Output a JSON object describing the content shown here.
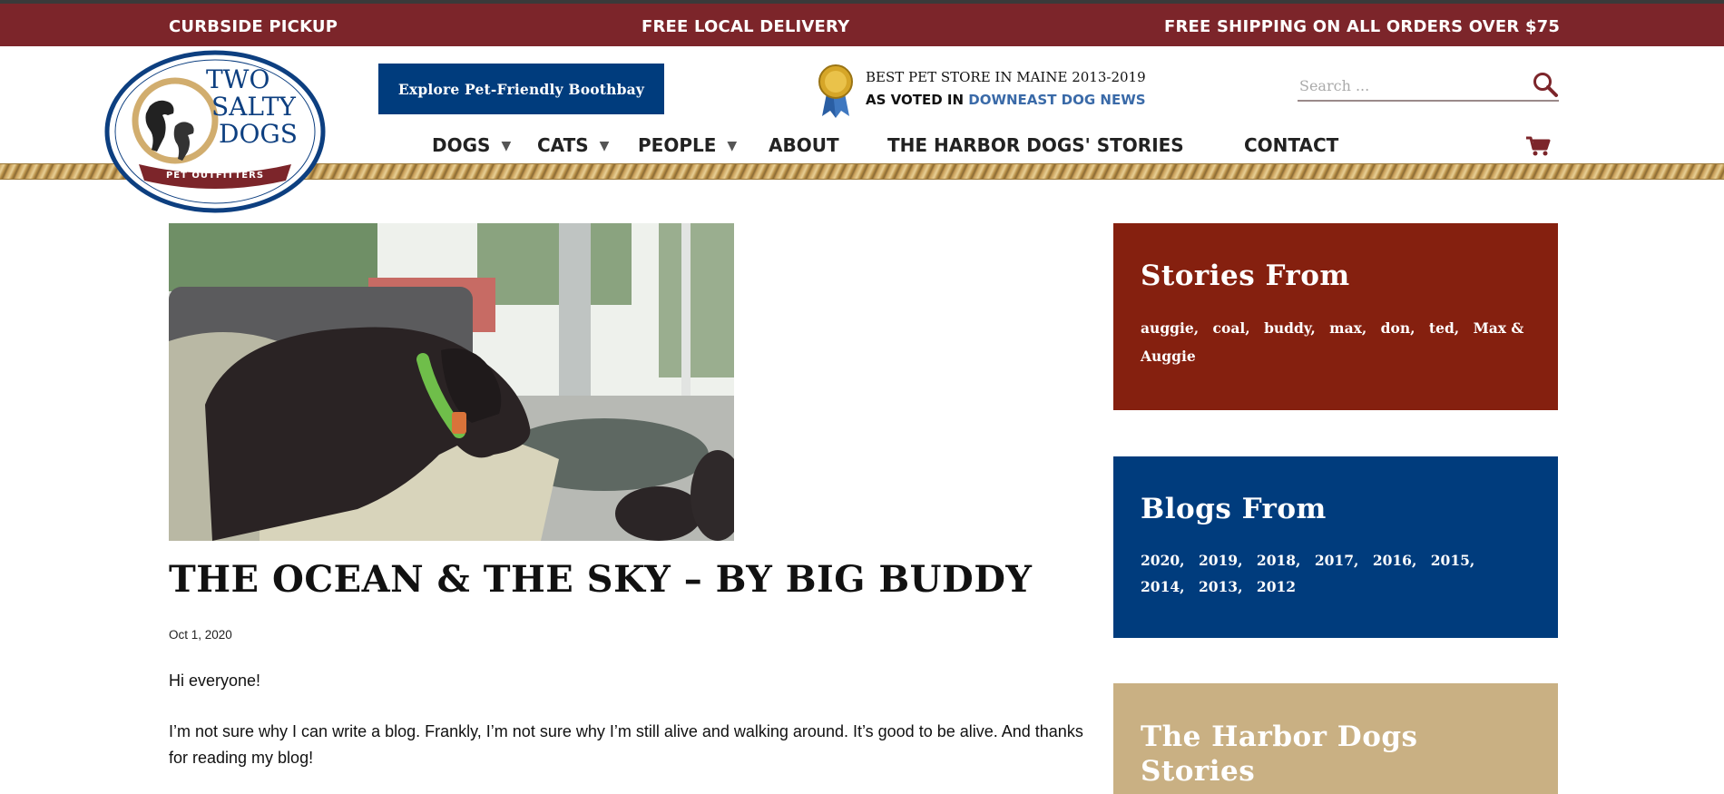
{
  "topbar": {
    "left": "CURBSIDE PICKUP",
    "center": "FREE LOCAL DELIVERY",
    "right": "FREE SHIPPING ON ALL ORDERS OVER $75"
  },
  "logo": {
    "line1": "TWO",
    "line2": "SALTY",
    "line3": "DOGS",
    "banner": "PET OUTFITTERS"
  },
  "header": {
    "explore_button": "Explore Pet-Friendly Boothbay",
    "award_line1": "BEST PET STORE IN MAINE 2013-2019",
    "award_line2_prefix": "AS VOTED IN ",
    "award_line2_publication": "DOWNEAST DOG NEWS",
    "search_placeholder": "Search ..."
  },
  "nav": {
    "items": [
      {
        "label": "DOGS",
        "has_caret": true
      },
      {
        "label": "CATS",
        "has_caret": true
      },
      {
        "label": "PEOPLE",
        "has_caret": true
      },
      {
        "label": "ABOUT",
        "has_caret": false
      },
      {
        "label": "THE HARBOR DOGS' STORIES",
        "has_caret": false
      },
      {
        "label": "CONTACT",
        "has_caret": false
      }
    ],
    "caret_glyph": "▼"
  },
  "post": {
    "title": "THE OCEAN & THE SKY – BY BIG BUDDY",
    "date": "Oct 1, 2020",
    "paragraph1": "Hi everyone!",
    "paragraph2": "I’m not sure why I can write a blog. Frankly, I’m not sure why I’m still alive and walking around. It’s good to be alive. And thanks for reading my blog!"
  },
  "sidebar": {
    "stories": {
      "title": "Stories From",
      "links": [
        "auggie,",
        "coal,",
        "buddy,",
        "max,",
        "don,",
        "ted,",
        "Max & Auggie"
      ],
      "color": "#85200f"
    },
    "blogs": {
      "title": "Blogs From",
      "links": [
        "2020,",
        "2019,",
        "2018,",
        "2017,",
        "2016,",
        "2015,",
        "2014,",
        "2013,",
        "2012"
      ],
      "color": "#003c7d"
    },
    "harbor": {
      "title": "The Harbor Dogs Stories",
      "color": "#c9b083"
    }
  },
  "colors": {
    "brand_red": "#7c252a",
    "brand_blue": "#003c7d",
    "rope_tan": "#c9a05a"
  },
  "icons": [
    "award-ribbon-icon",
    "search-icon",
    "cart-icon",
    "caret-down-icon"
  ]
}
